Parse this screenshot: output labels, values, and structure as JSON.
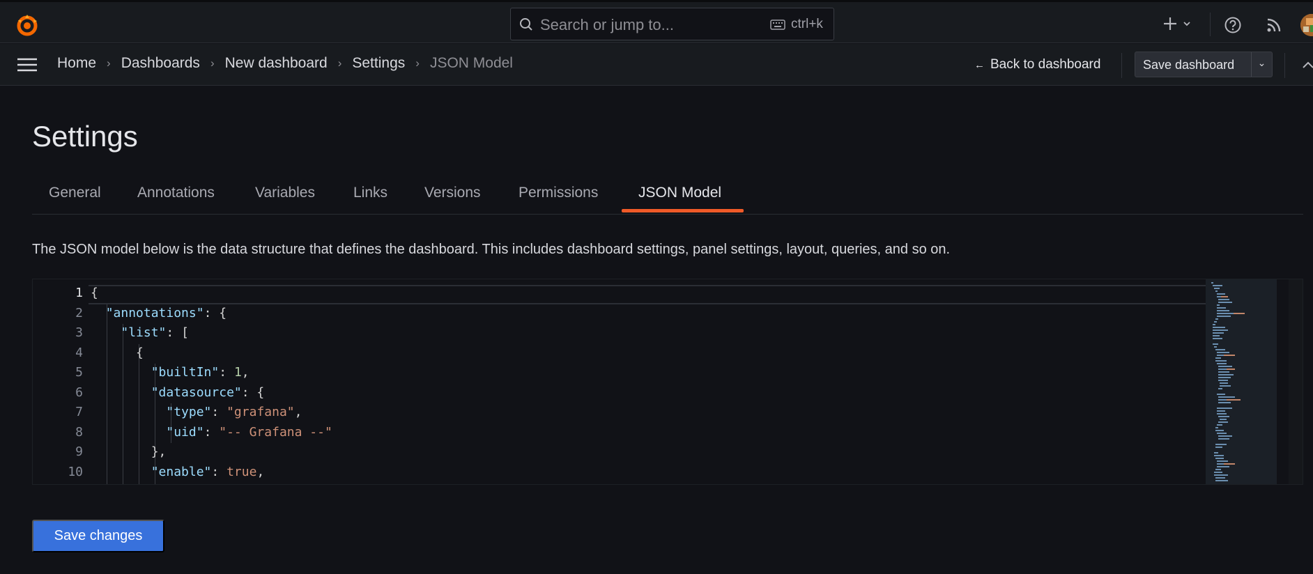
{
  "topbar": {
    "search_placeholder": "Search or jump to...",
    "search_shortcut": "ctrl+k"
  },
  "navbar": {
    "breadcrumbs": [
      "Home",
      "Dashboards",
      "New dashboard",
      "Settings",
      "JSON Model"
    ],
    "back_label": "Back to dashboard",
    "save_dashboard_label": "Save dashboard"
  },
  "page": {
    "title": "Settings",
    "tabs": [
      "General",
      "Annotations",
      "Variables",
      "Links",
      "Versions",
      "Permissions",
      "JSON Model"
    ],
    "active_tab": "JSON Model",
    "description": "The JSON model below is the data structure that defines the dashboard. This includes dashboard settings, panel settings, layout, queries, and so on."
  },
  "editor": {
    "line_numbers": [
      "1",
      "2",
      "3",
      "4",
      "5",
      "6",
      "7",
      "8",
      "9",
      "10"
    ],
    "lines": [
      "{",
      "  \"annotations\": {",
      "    \"list\": [",
      "      {",
      "        \"builtIn\": 1,",
      "        \"datasource\": {",
      "          \"type\": \"grafana\",",
      "          \"uid\": \"-- Grafana --\"",
      "        },",
      "        \"enable\": true,"
    ]
  },
  "footer": {
    "save_changes_label": "Save changes"
  },
  "colors": {
    "accent": "#f05a28",
    "primary_button": "#3871dc",
    "background": "#111217",
    "panel": "#181b1f"
  },
  "icons": [
    "grafana-logo-icon",
    "search-icon",
    "keyboard-icon",
    "plus-icon",
    "chevron-down-icon",
    "help-icon",
    "rss-icon",
    "avatar",
    "menu-icon",
    "arrow-left-icon",
    "collapse-icon"
  ]
}
